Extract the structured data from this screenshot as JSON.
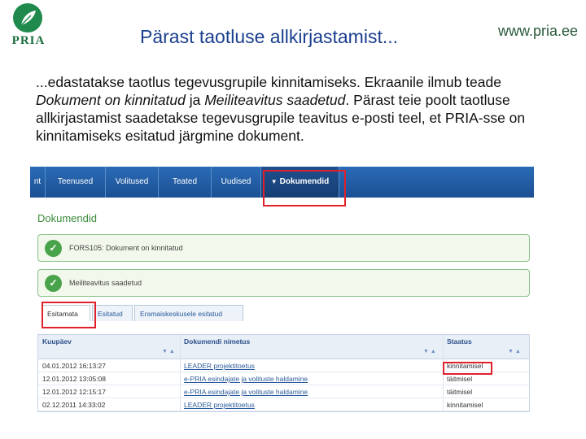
{
  "header": {
    "logo_text": "PRIA",
    "title": "Pärast taotluse allkirjastamist...",
    "url": "www.pria.ee"
  },
  "body": {
    "part1": "...edastatakse taotlus tegevusgrupile kinnitamiseks. Ekraanile ilmub teade ",
    "em1": "Dokument on kinnitatud",
    "part2": " ja ",
    "em2": "Meiliteavitus saadetud",
    "part3": ". Pärast teie poolt taotluse allkirjastamist saadetakse tegevusgrupile teavitus e-posti teel, et PRIA-sse on kinnitamiseks esitatud järgmine dokument."
  },
  "nav": {
    "items": [
      "nt",
      "Teenused",
      "Volitused",
      "Teated",
      "Uudised",
      "Dokumendid"
    ],
    "active_index": 5
  },
  "page_title": "Dokumendid",
  "messages": [
    "FORS105: Dokument on kinnitatud",
    "Meiliteavitus saadetud"
  ],
  "tabs": [
    "Esitamata",
    "Esitatud",
    "Eramaiskeskusele esitatud"
  ],
  "table": {
    "headers": [
      "Kuupäev",
      "Dokumendi nimetus",
      "Staatus"
    ],
    "sort_glyph": "▼ ▲",
    "rows": [
      [
        "04.01.2012 16:13:27",
        "LEADER projektitoetus",
        "kinnitamisel"
      ],
      [
        "12.01.2012 13:05:08",
        "e-PRIA esindajate ja volituste haldamine",
        "täitmisel"
      ],
      [
        "12.01.2012 12:15:17",
        "e-PRIA esindajate ja volituste haldamine",
        "täitmisel"
      ],
      [
        "02.12.2011 14:33:02",
        "LEADER projektitoetus",
        "kinnitamisel"
      ]
    ]
  },
  "colors": {
    "nav_blue": "#1c4f93",
    "title_blue": "#1a3f8f",
    "success_green": "#49a34a",
    "highlight_red": "#e0202a"
  }
}
